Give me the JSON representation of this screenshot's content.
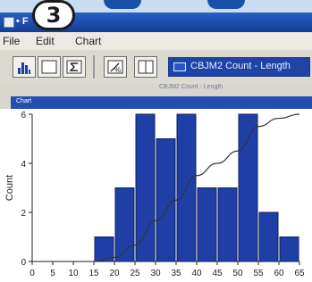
{
  "step_badge": "3",
  "window": {
    "title": "• F"
  },
  "menu": [
    "File",
    "Edit",
    "Chart"
  ],
  "toolbar": {
    "buttons": [
      "histogram-icon",
      "table-icon",
      "sigma-icon",
      "percent-icon",
      "split-icon"
    ],
    "combo_label": "CBJM2 Count - Length",
    "combo_swatch_color": "#2a55c8"
  },
  "caption": "CBJM2 Count - Length",
  "chart_tab_title": "Chart",
  "chart_data": {
    "type": "bar",
    "xlabel": "",
    "ylabel": "Count",
    "x_ticks": [
      0,
      5,
      10,
      15,
      20,
      25,
      30,
      35,
      40,
      45,
      50,
      55,
      60,
      65
    ],
    "y_ticks": [
      0,
      2,
      4,
      6
    ],
    "xlim": [
      0,
      65
    ],
    "ylim": [
      0,
      6
    ],
    "bin_width": 5,
    "bins": [
      {
        "start": 15,
        "count": 1
      },
      {
        "start": 20,
        "count": 3
      },
      {
        "start": 25,
        "count": 6
      },
      {
        "start": 30,
        "count": 5
      },
      {
        "start": 35,
        "count": 6
      },
      {
        "start": 40,
        "count": 3
      },
      {
        "start": 45,
        "count": 3
      },
      {
        "start": 50,
        "count": 6
      },
      {
        "start": 55,
        "count": 2
      },
      {
        "start": 60,
        "count": 1
      }
    ],
    "cumulative_line": true,
    "bar_color": "#1f3fa6"
  }
}
